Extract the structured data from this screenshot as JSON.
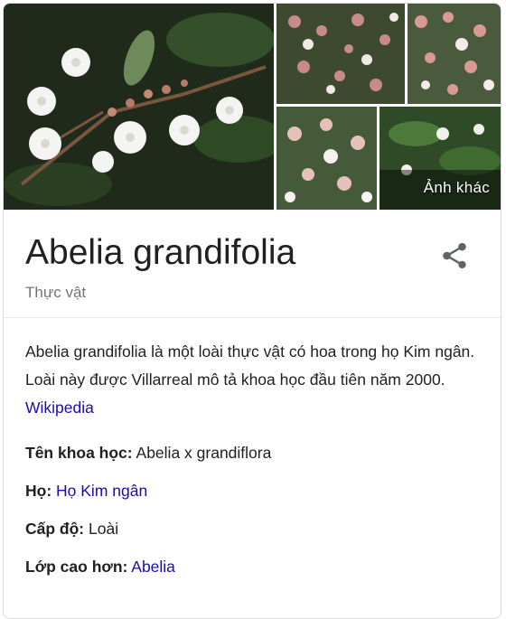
{
  "gallery": {
    "more_label": "Ảnh khác"
  },
  "knowledge_panel": {
    "title": "Abelia grandifolia",
    "subtitle": "Thực vật",
    "description": "Abelia grandifolia là một loài thực vật có hoa trong họ Kim ngân. Loài này được Villarreal mô tả khoa học đầu tiên năm 2000.",
    "source_link": "Wikipedia",
    "share_icon": "share-icon"
  },
  "facts": [
    {
      "label": "Tên khoa học:",
      "value": "Abelia x grandiflora",
      "is_link": false
    },
    {
      "label": "Họ:",
      "value": "Họ Kim ngân",
      "is_link": true
    },
    {
      "label": "Cấp độ:",
      "value": "Loài",
      "is_link": false
    },
    {
      "label": "Lớp cao hơn:",
      "value": "Abelia",
      "is_link": true
    }
  ],
  "colors": {
    "link": "#1a0dab",
    "subtle_text": "#70757a",
    "border": "#dadce0"
  }
}
